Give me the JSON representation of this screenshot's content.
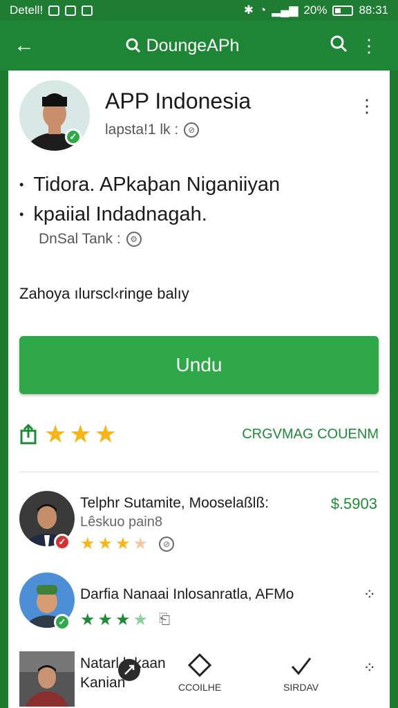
{
  "status": {
    "carrier": "Detell!",
    "battery_pct": "20%",
    "time": "88:31"
  },
  "app_bar": {
    "title": "DoungeAPh"
  },
  "app": {
    "name": "APP Indonesia",
    "subtitle": "lapsta!1 lk :",
    "bullets": [
      "Tidora. APkaþan Niganiiyan",
      "kpaiial Indadnagah."
    ],
    "developer": "DnSal Tank :",
    "description": "Zahoya ılurscl‹ringe balıy",
    "install_label": "Undu",
    "rating_link": "CRGVMAG COUENM"
  },
  "reviews": [
    {
      "name": "Telphr Sutamite, Mooselaßlß:",
      "sub": "Lêskuo pain8",
      "price": "$.5903",
      "stars": 3.5
    },
    {
      "name": "Darfia Nanaai Inlosanratla, AFMo",
      "sub": "",
      "price": "",
      "stars": 3.5
    },
    {
      "name": "Natarl lekaan",
      "sub": "Kanian",
      "price": "",
      "stars": 0
    }
  ],
  "bottom_nav": [
    {
      "label": "CCOILHE",
      "icon": "diamond-icon"
    },
    {
      "label": "SIRDAV",
      "icon": "check-icon"
    }
  ],
  "colors": {
    "primary": "#1f8536",
    "button": "#2fa84a",
    "star": "#f6b619",
    "review_star": "#1e8a38"
  }
}
